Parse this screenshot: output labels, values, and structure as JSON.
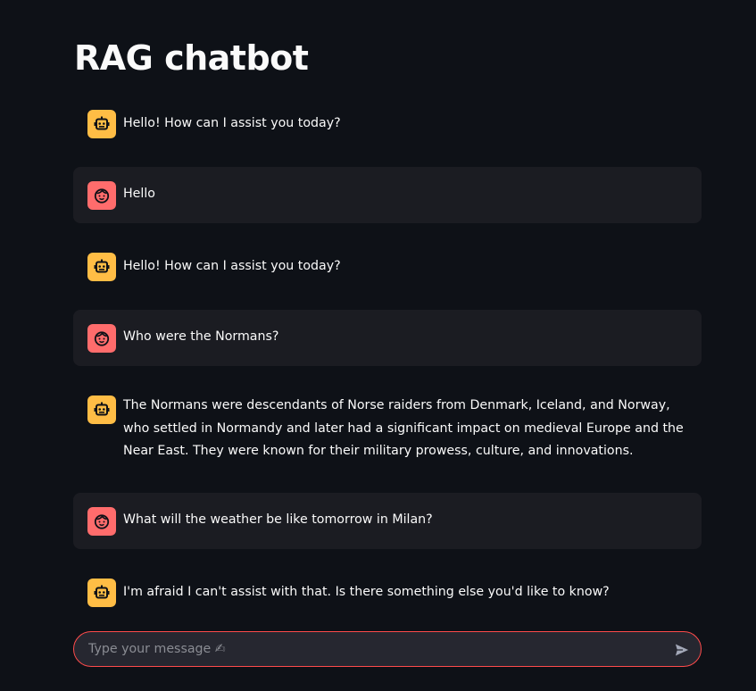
{
  "app": {
    "title": "RAG chatbot"
  },
  "messages": [
    {
      "role": "assistant",
      "text": "Hello! How can I assist you today?"
    },
    {
      "role": "user",
      "text": "Hello"
    },
    {
      "role": "assistant",
      "text": "Hello! How can I assist you today?"
    },
    {
      "role": "user",
      "text": "Who were the Normans?"
    },
    {
      "role": "assistant",
      "text": "The Normans were descendants of Norse raiders from Denmark, Iceland, and Norway, who settled in Normandy and later had a significant impact on medieval Europe and the Near East. They were known for their military prowess, culture, and innovations."
    },
    {
      "role": "user",
      "text": "What will the weather be like tomorrow in Milan?"
    },
    {
      "role": "assistant",
      "text": "I'm afraid I can't assist with that. Is there something else you'd like to know?"
    }
  ],
  "chat_input": {
    "placeholder": "Type your message ✍",
    "value": ""
  },
  "icons": {
    "assistant_avatar": "robot-icon",
    "user_avatar": "face-icon",
    "send": "send-icon"
  },
  "colors": {
    "background": "#0e1117",
    "user_message_bg": "#1b1c22",
    "assistant_avatar": "#ffbd45",
    "user_avatar": "#ff6c6c",
    "input_border": "#ff4b4b",
    "input_bg": "#262730"
  }
}
